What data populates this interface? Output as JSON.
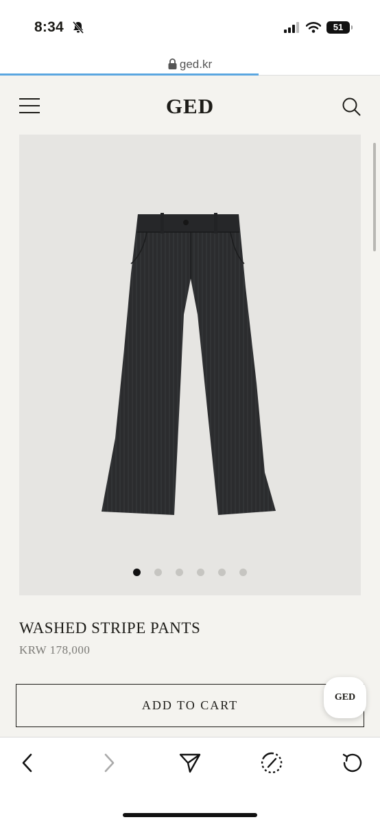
{
  "status_bar": {
    "time": "8:34",
    "battery": "51"
  },
  "browser": {
    "url": "ged.kr",
    "load_progress": 0.68
  },
  "header": {
    "brand": "GED"
  },
  "gallery": {
    "image_count": 6,
    "active_index": 0
  },
  "product": {
    "name": "WASHED STRIPE PANTS",
    "price": "KRW 178,000"
  },
  "actions": {
    "add_to_cart": "ADD TO CART",
    "floating_badge": "GED"
  },
  "colors": {
    "accent": "#1c1b17",
    "background": "#f4f3ef",
    "progress": "#5aa6e0",
    "product": "#2b2c2e"
  },
  "icons": [
    "bell-slash-icon",
    "cellular-signal-icon",
    "wifi-icon",
    "battery-icon",
    "lock-icon",
    "hamburger-menu-icon",
    "search-icon",
    "back-arrow-icon",
    "forward-arrow-icon",
    "share-send-icon",
    "speed-dial-icon",
    "reload-icon"
  ]
}
